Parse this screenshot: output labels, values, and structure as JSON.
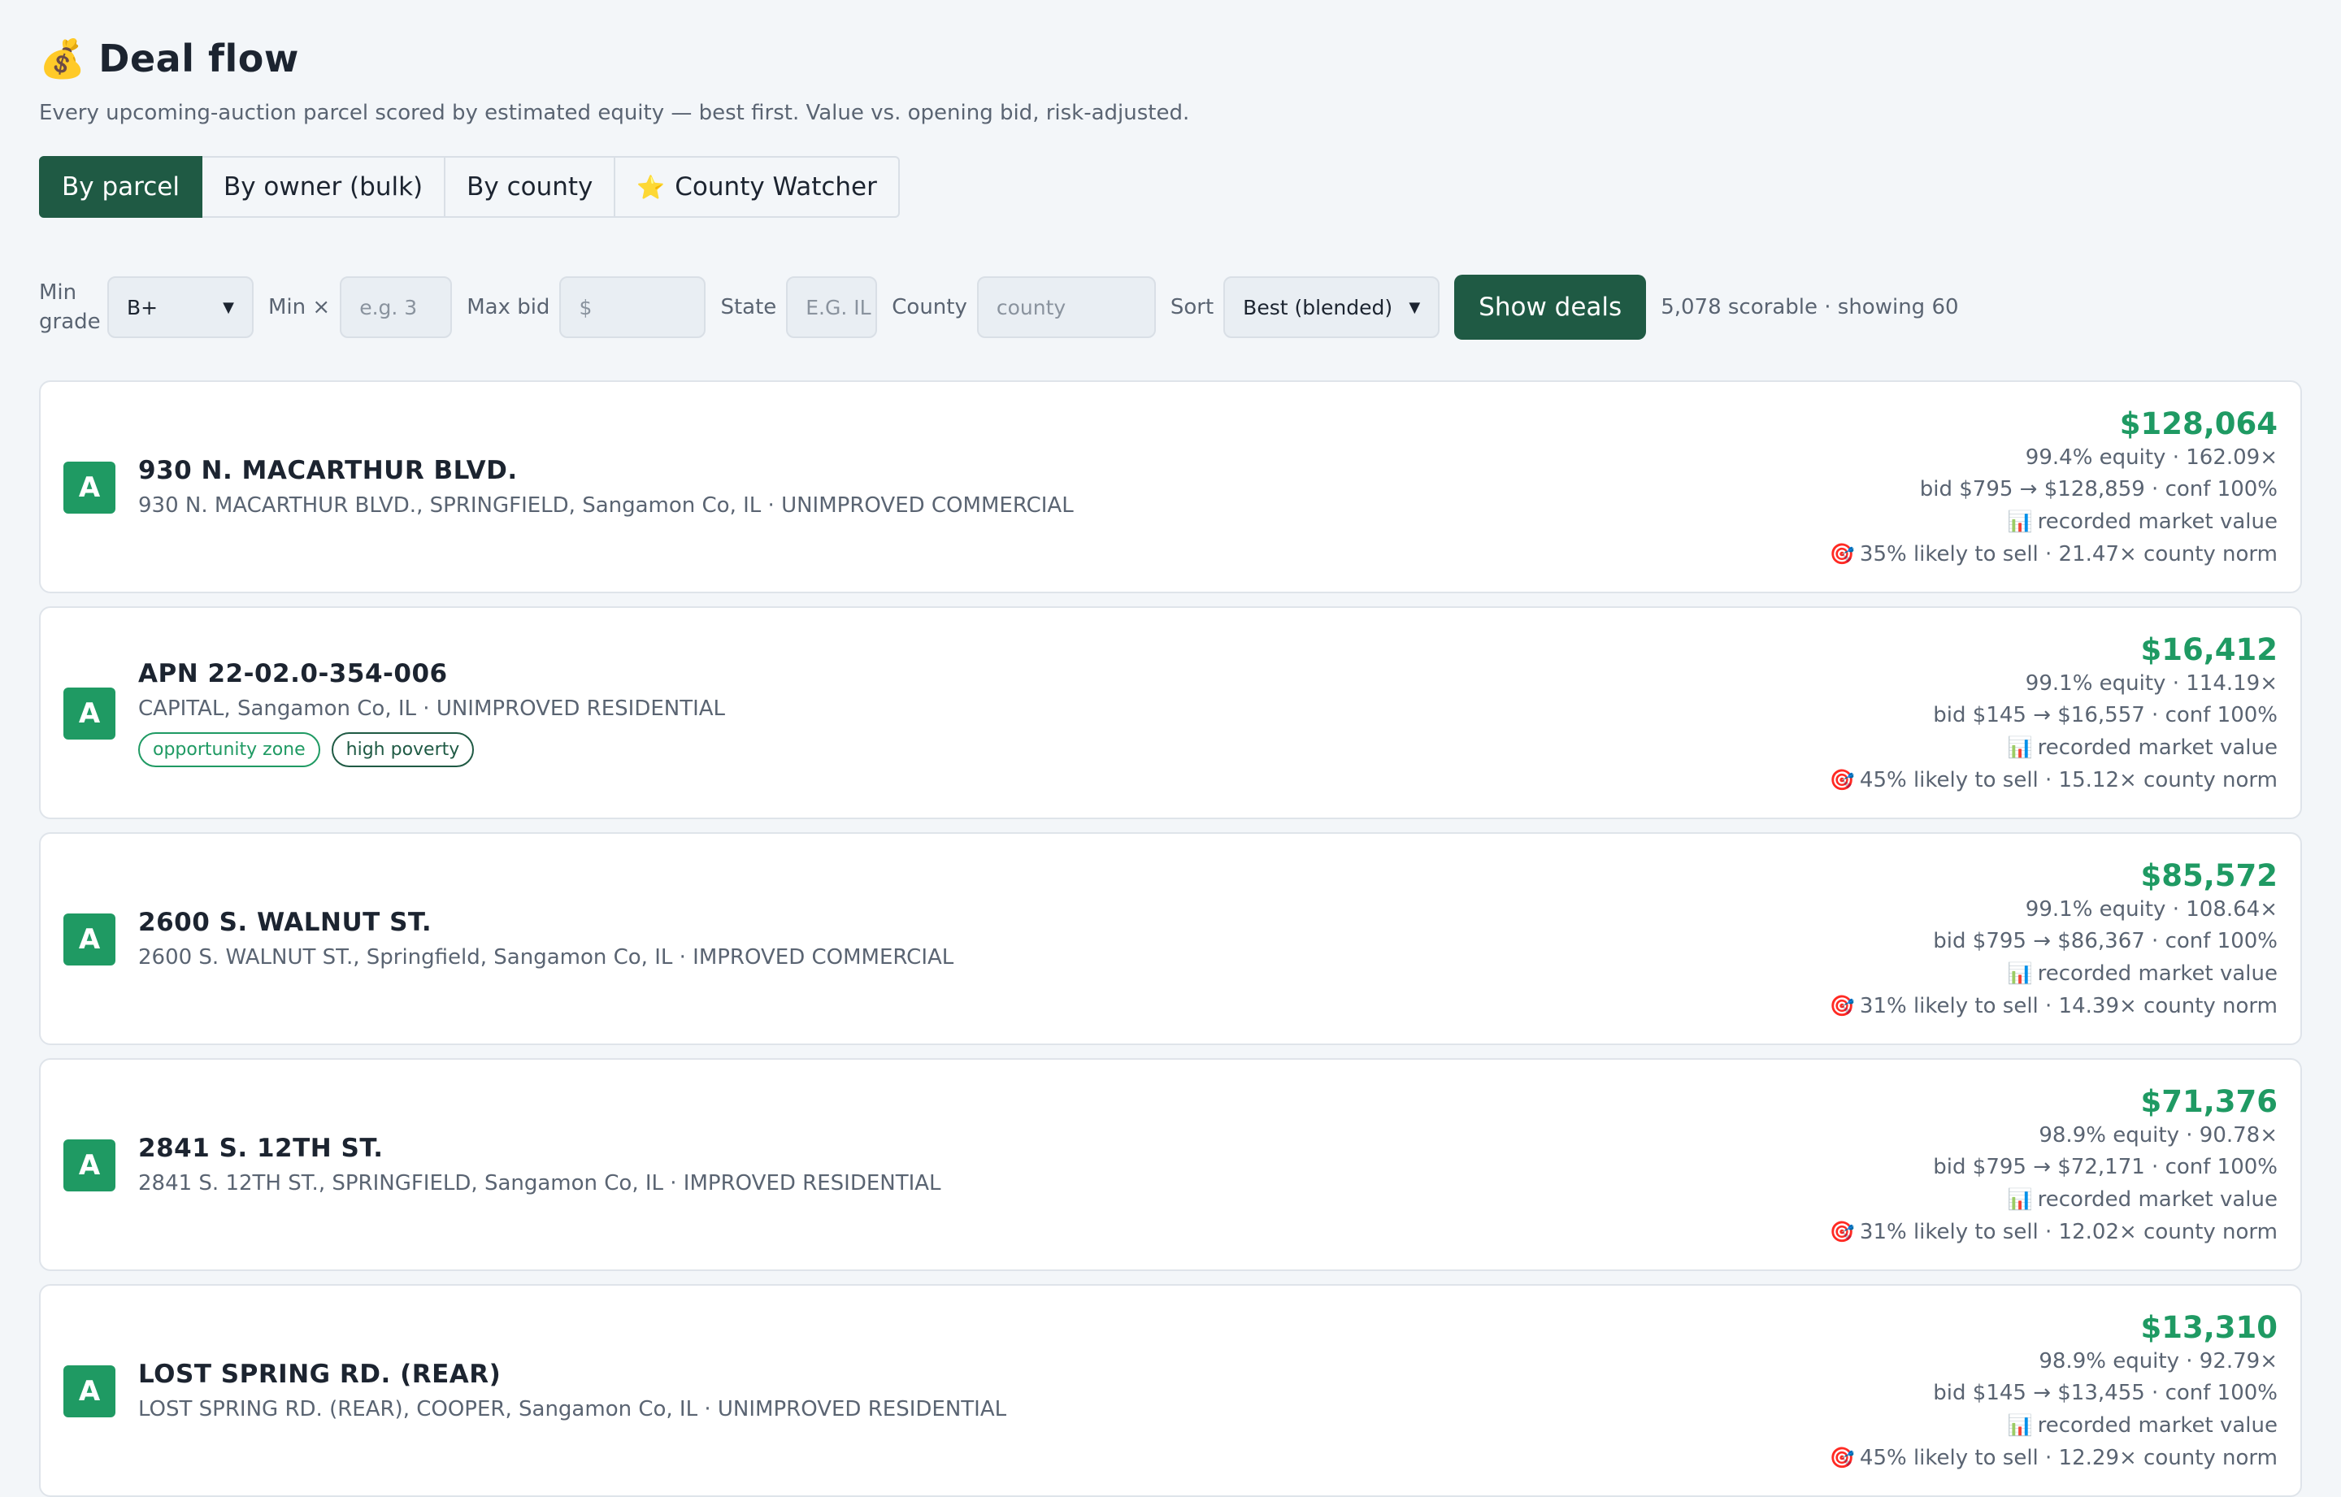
{
  "header": {
    "emoji": "💰",
    "title": "Deal flow",
    "subtitle": "Every upcoming-auction parcel scored by estimated equity — best first. Value vs. opening bid, risk-adjusted."
  },
  "tabs": [
    {
      "label": "By parcel",
      "active": true
    },
    {
      "label": "By owner (bulk)",
      "active": false
    },
    {
      "label": "By county",
      "active": false
    },
    {
      "label": "County Watcher",
      "active": false,
      "icon": "⭐"
    }
  ],
  "filters": {
    "min_grade_label": "Min grade",
    "min_grade_value": "B+",
    "min_x_label": "Min ×",
    "min_x_placeholder": "e.g. 3",
    "max_bid_label": "Max bid",
    "max_bid_placeholder": "$",
    "state_label": "State",
    "state_placeholder": "E.G. IL",
    "county_label": "County",
    "county_placeholder": "county",
    "sort_label": "Sort",
    "sort_value": "Best (blended)",
    "show_button": "Show deals",
    "count_text": "5,078 scorable · showing 60"
  },
  "deals": [
    {
      "grade": "A",
      "title": "930 N. MACARTHUR BLVD.",
      "sub": "930 N. MACARTHUR BLVD., SPRINGFIELD, Sangamon Co, IL · UNIMPROVED COMMERCIAL",
      "tags": [],
      "amount": "$128,064",
      "equity": "99.4% equity · 162.09×",
      "bid": "bid $795 → $128,859 · conf 100%",
      "source_icon": "📊",
      "source": "recorded market value",
      "likely_icon": "🎯",
      "likely": "35% likely to sell · 21.47× county norm"
    },
    {
      "grade": "A",
      "title": "APN 22-02.0-354-006",
      "sub": "CAPITAL, Sangamon Co, IL · UNIMPROVED RESIDENTIAL",
      "tags": [
        "opportunity zone",
        "high poverty"
      ],
      "amount": "$16,412",
      "equity": "99.1% equity · 114.19×",
      "bid": "bid $145 → $16,557 · conf 100%",
      "source_icon": "📊",
      "source": "recorded market value",
      "likely_icon": "🎯",
      "likely": "45% likely to sell · 15.12× county norm"
    },
    {
      "grade": "A",
      "title": "2600 S. WALNUT ST.",
      "sub": "2600 S. WALNUT ST., Springfield, Sangamon Co, IL · IMPROVED COMMERCIAL",
      "tags": [],
      "amount": "$85,572",
      "equity": "99.1% equity · 108.64×",
      "bid": "bid $795 → $86,367 · conf 100%",
      "source_icon": "📊",
      "source": "recorded market value",
      "likely_icon": "🎯",
      "likely": "31% likely to sell · 14.39× county norm"
    },
    {
      "grade": "A",
      "title": "2841 S. 12TH ST.",
      "sub": "2841 S. 12TH ST., SPRINGFIELD, Sangamon Co, IL · IMPROVED RESIDENTIAL",
      "tags": [],
      "amount": "$71,376",
      "equity": "98.9% equity · 90.78×",
      "bid": "bid $795 → $72,171 · conf 100%",
      "source_icon": "📊",
      "source": "recorded market value",
      "likely_icon": "🎯",
      "likely": "31% likely to sell · 12.02× county norm"
    },
    {
      "grade": "A",
      "title": "LOST SPRING RD. (REAR)",
      "sub": "LOST SPRING RD. (REAR), COOPER, Sangamon Co, IL · UNIMPROVED RESIDENTIAL",
      "tags": [],
      "amount": "$13,310",
      "equity": "98.9% equity · 92.79×",
      "bid": "bid $145 → $13,455 · conf 100%",
      "source_icon": "📊",
      "source": "recorded market value",
      "likely_icon": "🎯",
      "likely": "45% likely to sell · 12.29× county norm"
    }
  ]
}
